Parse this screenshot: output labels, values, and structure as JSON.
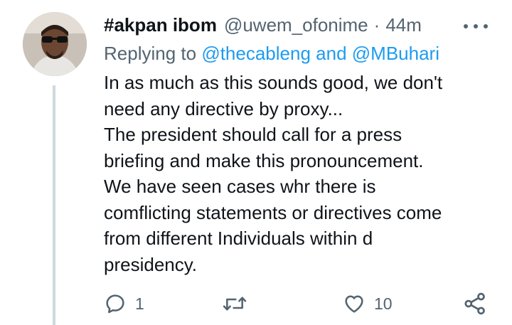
{
  "tweet": {
    "display_name": "#akpan ibom",
    "handle": "@uwem_ofonime",
    "separator": "·",
    "time": "44m",
    "reply_prefix": "Replying to ",
    "reply_mention_1": "@thecableng",
    "reply_conjunction": " and ",
    "reply_mention_2": "@MBuhari",
    "text_lines": [
      "In as much as this sounds good, we don't",
      "need any directive by proxy...",
      "The president should call for a press",
      "briefing and make this pronouncement.",
      "We have seen cases whr there is",
      "comflicting statements or directives come",
      "from different Individuals within d",
      "presidency."
    ],
    "reply_count": "1",
    "like_count": "10"
  },
  "colors": {
    "text": "#0f1419",
    "secondary": "#536471",
    "accent": "#1d9bf0",
    "thread_line": "#cfd9de"
  },
  "icons": [
    "more-icon",
    "reply-icon",
    "retweet-icon",
    "like-icon",
    "share-icon"
  ]
}
